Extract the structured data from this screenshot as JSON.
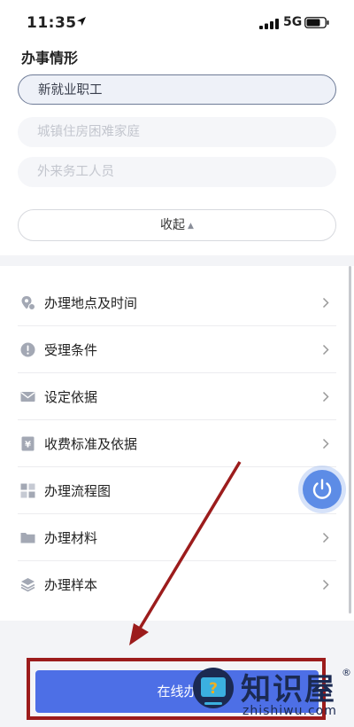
{
  "status_bar": {
    "time": "11:35",
    "network": "5G",
    "location_icon": "location-arrow-icon",
    "signal_icon": "signal-bars-icon",
    "battery_icon": "battery-icon"
  },
  "top_panel": {
    "title": "办事情形",
    "options": [
      {
        "label": "新就业职工",
        "selected": true
      },
      {
        "label": "城镇住房困难家庭",
        "selected": false
      },
      {
        "label": "外来务工人员",
        "selected": false
      }
    ],
    "collapse_label": "收起"
  },
  "list": {
    "items": [
      {
        "label": "办理地点及时间",
        "icon": "location-pin-icon"
      },
      {
        "label": "受理条件",
        "icon": "alert-circle-icon"
      },
      {
        "label": "设定依据",
        "icon": "envelope-icon"
      },
      {
        "label": "收费标准及依据",
        "icon": "yuan-document-icon"
      },
      {
        "label": "办理流程图",
        "icon": "grid-icon"
      },
      {
        "label": "办理材料",
        "icon": "folder-icon"
      },
      {
        "label": "办理样本",
        "icon": "layers-icon"
      }
    ]
  },
  "floating_button": {
    "icon": "power-icon"
  },
  "bottom_button": {
    "label": "在线办"
  },
  "watermark": {
    "text": "知识屋",
    "subtext": "zhishiwu.com",
    "reg": "®"
  },
  "colors": {
    "primary": "#4d6fe6",
    "annotation": "#9c1c1c",
    "float": "#5d8ce6"
  }
}
